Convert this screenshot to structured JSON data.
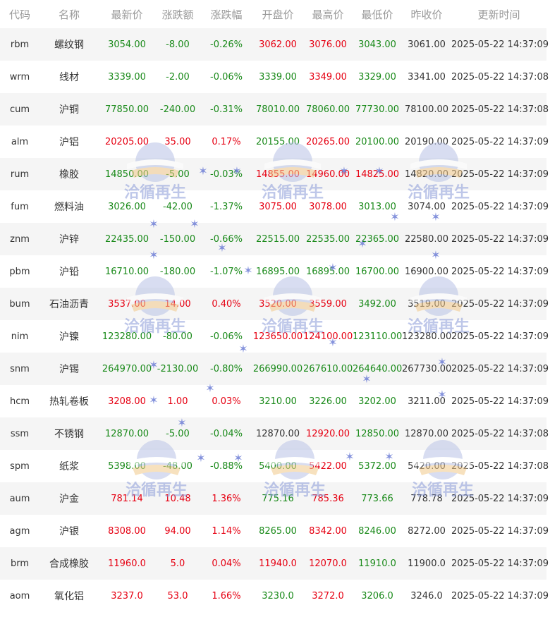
{
  "columns": [
    "代码",
    "名称",
    "最新价",
    "涨跌额",
    "涨跌幅",
    "开盘价",
    "最高价",
    "最低价",
    "昨收价",
    "更新时间"
  ],
  "colors": {
    "up": "#e60012",
    "down": "#1a8a1a",
    "flat": "#333333",
    "header": "#999999",
    "watermark": "#8a9bd8"
  },
  "watermark": {
    "text": "洽循再生",
    "icon": "globe-logo-icon",
    "star": "star-icon"
  },
  "rows": [
    {
      "code": "rbm",
      "name": "螺纹钢",
      "last": "3054.00",
      "chg": "-8.00",
      "pct": "-0.26%",
      "open": "3062.00",
      "high": "3076.00",
      "low": "3043.00",
      "prev": "3061.00",
      "time": "2025-05-22 14:37:09",
      "c": {
        "last": "down",
        "chg": "down",
        "pct": "down",
        "open": "up",
        "high": "up",
        "low": "down"
      }
    },
    {
      "code": "wrm",
      "name": "线材",
      "last": "3339.00",
      "chg": "-2.00",
      "pct": "-0.06%",
      "open": "3339.00",
      "high": "3349.00",
      "low": "3329.00",
      "prev": "3341.00",
      "time": "2025-05-22 14:37:08",
      "c": {
        "last": "down",
        "chg": "down",
        "pct": "down",
        "open": "down",
        "high": "up",
        "low": "down"
      }
    },
    {
      "code": "cum",
      "name": "沪铜",
      "last": "77850.00",
      "chg": "-240.00",
      "pct": "-0.31%",
      "open": "78010.00",
      "high": "78060.00",
      "low": "77730.00",
      "prev": "78100.00",
      "time": "2025-05-22 14:37:08",
      "c": {
        "last": "down",
        "chg": "down",
        "pct": "down",
        "open": "down",
        "high": "down",
        "low": "down"
      }
    },
    {
      "code": "alm",
      "name": "沪铝",
      "last": "20205.00",
      "chg": "35.00",
      "pct": "0.17%",
      "open": "20155.00",
      "high": "20265.00",
      "low": "20100.00",
      "prev": "20190.00",
      "time": "2025-05-22 14:37:09",
      "c": {
        "last": "up",
        "chg": "up",
        "pct": "up",
        "open": "down",
        "high": "up",
        "low": "down"
      }
    },
    {
      "code": "rum",
      "name": "橡胶",
      "last": "14850.00",
      "chg": "-5.00",
      "pct": "-0.03%",
      "open": "14855.00",
      "high": "14960.00",
      "low": "14825.00",
      "prev": "14820.00",
      "time": "2025-05-22 14:37:09",
      "c": {
        "last": "down",
        "chg": "down",
        "pct": "down",
        "open": "up",
        "high": "up",
        "low": "up"
      }
    },
    {
      "code": "fum",
      "name": "燃料油",
      "last": "3026.00",
      "chg": "-42.00",
      "pct": "-1.37%",
      "open": "3075.00",
      "high": "3078.00",
      "low": "3013.00",
      "prev": "3074.00",
      "time": "2025-05-22 14:37:09",
      "c": {
        "last": "down",
        "chg": "down",
        "pct": "down",
        "open": "up",
        "high": "up",
        "low": "down"
      }
    },
    {
      "code": "znm",
      "name": "沪锌",
      "last": "22435.00",
      "chg": "-150.00",
      "pct": "-0.66%",
      "open": "22515.00",
      "high": "22535.00",
      "low": "22365.00",
      "prev": "22580.00",
      "time": "2025-05-22 14:37:09",
      "c": {
        "last": "down",
        "chg": "down",
        "pct": "down",
        "open": "down",
        "high": "down",
        "low": "down"
      }
    },
    {
      "code": "pbm",
      "name": "沪铅",
      "last": "16710.00",
      "chg": "-180.00",
      "pct": "-1.07%",
      "open": "16895.00",
      "high": "16895.00",
      "low": "16700.00",
      "prev": "16900.00",
      "time": "2025-05-22 14:37:09",
      "c": {
        "last": "down",
        "chg": "down",
        "pct": "down",
        "open": "down",
        "high": "down",
        "low": "down"
      }
    },
    {
      "code": "bum",
      "name": "石油沥青",
      "last": "3537.00",
      "chg": "14.00",
      "pct": "0.40%",
      "open": "3520.00",
      "high": "3559.00",
      "low": "3492.00",
      "prev": "3519.00",
      "time": "2025-05-22 14:37:09",
      "c": {
        "last": "up",
        "chg": "up",
        "pct": "up",
        "open": "up",
        "high": "up",
        "low": "down"
      }
    },
    {
      "code": "nim",
      "name": "沪镍",
      "last": "123280.00",
      "chg": "-80.00",
      "pct": "-0.06%",
      "open": "123650.00",
      "high": "124100.00",
      "low": "123110.00",
      "prev": "123280.00",
      "time": "2025-05-22 14:37:09",
      "c": {
        "last": "down",
        "chg": "down",
        "pct": "down",
        "open": "up",
        "high": "up",
        "low": "down"
      }
    },
    {
      "code": "snm",
      "name": "沪锡",
      "last": "264970.00",
      "chg": "-2130.00",
      "pct": "-0.80%",
      "open": "266990.00",
      "high": "267610.00",
      "low": "264640.00",
      "prev": "267730.00",
      "time": "2025-05-22 14:37:09",
      "c": {
        "last": "down",
        "chg": "down",
        "pct": "down",
        "open": "down",
        "high": "down",
        "low": "down"
      }
    },
    {
      "code": "hcm",
      "name": "热轧卷板",
      "last": "3208.00",
      "chg": "1.00",
      "pct": "0.03%",
      "open": "3210.00",
      "high": "3226.00",
      "low": "3202.00",
      "prev": "3211.00",
      "time": "2025-05-22 14:37:09",
      "c": {
        "last": "up",
        "chg": "up",
        "pct": "up",
        "open": "down",
        "high": "down",
        "low": "down"
      }
    },
    {
      "code": "ssm",
      "name": "不锈钢",
      "last": "12870.00",
      "chg": "-5.00",
      "pct": "-0.04%",
      "open": "12870.00",
      "high": "12920.00",
      "low": "12850.00",
      "prev": "12870.00",
      "time": "2025-05-22 14:37:08",
      "c": {
        "last": "down",
        "chg": "down",
        "pct": "down",
        "open": "flat",
        "high": "up",
        "low": "down"
      }
    },
    {
      "code": "spm",
      "name": "纸浆",
      "last": "5398.00",
      "chg": "-48.00",
      "pct": "-0.88%",
      "open": "5400.00",
      "high": "5422.00",
      "low": "5372.00",
      "prev": "5420.00",
      "time": "2025-05-22 14:37:08",
      "c": {
        "last": "down",
        "chg": "down",
        "pct": "down",
        "open": "down",
        "high": "up",
        "low": "down"
      }
    },
    {
      "code": "aum",
      "name": "沪金",
      "last": "781.14",
      "chg": "10.48",
      "pct": "1.36%",
      "open": "775.16",
      "high": "785.36",
      "low": "773.66",
      "prev": "778.78",
      "time": "2025-05-22 14:37:09",
      "c": {
        "last": "up",
        "chg": "up",
        "pct": "up",
        "open": "down",
        "high": "up",
        "low": "down"
      }
    },
    {
      "code": "agm",
      "name": "沪银",
      "last": "8308.00",
      "chg": "94.00",
      "pct": "1.14%",
      "open": "8265.00",
      "high": "8342.00",
      "low": "8246.00",
      "prev": "8272.00",
      "time": "2025-05-22 14:37:09",
      "c": {
        "last": "up",
        "chg": "up",
        "pct": "up",
        "open": "down",
        "high": "up",
        "low": "down"
      }
    },
    {
      "code": "brm",
      "name": "合成橡胶",
      "last": "11960.0",
      "chg": "5.0",
      "pct": "0.04%",
      "open": "11940.0",
      "high": "12070.0",
      "low": "11910.0",
      "prev": "11900.0",
      "time": "2025-05-22 14:37:09",
      "c": {
        "last": "up",
        "chg": "up",
        "pct": "up",
        "open": "up",
        "high": "up",
        "low": "down"
      }
    },
    {
      "code": "aom",
      "name": "氧化铝",
      "last": "3237.0",
      "chg": "53.0",
      "pct": "1.66%",
      "open": "3230.0",
      "high": "3272.0",
      "low": "3206.0",
      "prev": "3246.0",
      "time": "2025-05-22 14:37:09",
      "c": {
        "last": "up",
        "chg": "up",
        "pct": "up",
        "open": "down",
        "high": "up",
        "low": "down"
      }
    }
  ]
}
